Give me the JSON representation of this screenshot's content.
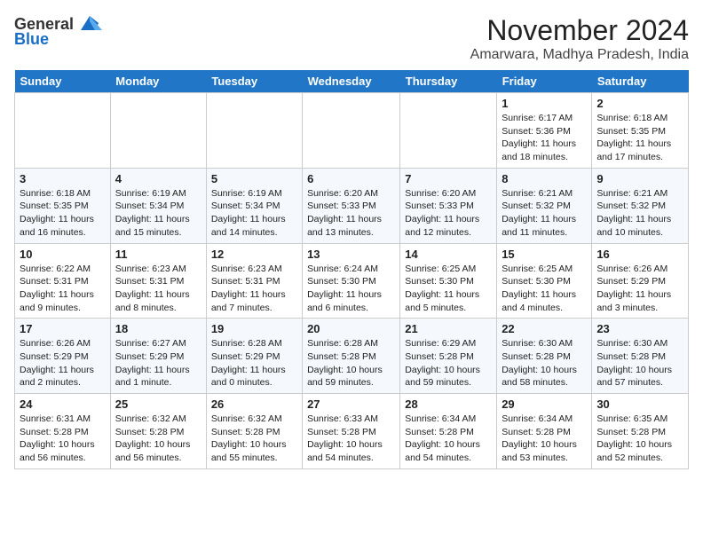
{
  "header": {
    "logo_general": "General",
    "logo_blue": "Blue",
    "month": "November 2024",
    "location": "Amarwara, Madhya Pradesh, India"
  },
  "days_of_week": [
    "Sunday",
    "Monday",
    "Tuesday",
    "Wednesday",
    "Thursday",
    "Friday",
    "Saturday"
  ],
  "weeks": [
    [
      {
        "day": "",
        "info": ""
      },
      {
        "day": "",
        "info": ""
      },
      {
        "day": "",
        "info": ""
      },
      {
        "day": "",
        "info": ""
      },
      {
        "day": "",
        "info": ""
      },
      {
        "day": "1",
        "info": "Sunrise: 6:17 AM\nSunset: 5:36 PM\nDaylight: 11 hours and 18 minutes."
      },
      {
        "day": "2",
        "info": "Sunrise: 6:18 AM\nSunset: 5:35 PM\nDaylight: 11 hours and 17 minutes."
      }
    ],
    [
      {
        "day": "3",
        "info": "Sunrise: 6:18 AM\nSunset: 5:35 PM\nDaylight: 11 hours and 16 minutes."
      },
      {
        "day": "4",
        "info": "Sunrise: 6:19 AM\nSunset: 5:34 PM\nDaylight: 11 hours and 15 minutes."
      },
      {
        "day": "5",
        "info": "Sunrise: 6:19 AM\nSunset: 5:34 PM\nDaylight: 11 hours and 14 minutes."
      },
      {
        "day": "6",
        "info": "Sunrise: 6:20 AM\nSunset: 5:33 PM\nDaylight: 11 hours and 13 minutes."
      },
      {
        "day": "7",
        "info": "Sunrise: 6:20 AM\nSunset: 5:33 PM\nDaylight: 11 hours and 12 minutes."
      },
      {
        "day": "8",
        "info": "Sunrise: 6:21 AM\nSunset: 5:32 PM\nDaylight: 11 hours and 11 minutes."
      },
      {
        "day": "9",
        "info": "Sunrise: 6:21 AM\nSunset: 5:32 PM\nDaylight: 11 hours and 10 minutes."
      }
    ],
    [
      {
        "day": "10",
        "info": "Sunrise: 6:22 AM\nSunset: 5:31 PM\nDaylight: 11 hours and 9 minutes."
      },
      {
        "day": "11",
        "info": "Sunrise: 6:23 AM\nSunset: 5:31 PM\nDaylight: 11 hours and 8 minutes."
      },
      {
        "day": "12",
        "info": "Sunrise: 6:23 AM\nSunset: 5:31 PM\nDaylight: 11 hours and 7 minutes."
      },
      {
        "day": "13",
        "info": "Sunrise: 6:24 AM\nSunset: 5:30 PM\nDaylight: 11 hours and 6 minutes."
      },
      {
        "day": "14",
        "info": "Sunrise: 6:25 AM\nSunset: 5:30 PM\nDaylight: 11 hours and 5 minutes."
      },
      {
        "day": "15",
        "info": "Sunrise: 6:25 AM\nSunset: 5:30 PM\nDaylight: 11 hours and 4 minutes."
      },
      {
        "day": "16",
        "info": "Sunrise: 6:26 AM\nSunset: 5:29 PM\nDaylight: 11 hours and 3 minutes."
      }
    ],
    [
      {
        "day": "17",
        "info": "Sunrise: 6:26 AM\nSunset: 5:29 PM\nDaylight: 11 hours and 2 minutes."
      },
      {
        "day": "18",
        "info": "Sunrise: 6:27 AM\nSunset: 5:29 PM\nDaylight: 11 hours and 1 minute."
      },
      {
        "day": "19",
        "info": "Sunrise: 6:28 AM\nSunset: 5:29 PM\nDaylight: 11 hours and 0 minutes."
      },
      {
        "day": "20",
        "info": "Sunrise: 6:28 AM\nSunset: 5:28 PM\nDaylight: 10 hours and 59 minutes."
      },
      {
        "day": "21",
        "info": "Sunrise: 6:29 AM\nSunset: 5:28 PM\nDaylight: 10 hours and 59 minutes."
      },
      {
        "day": "22",
        "info": "Sunrise: 6:30 AM\nSunset: 5:28 PM\nDaylight: 10 hours and 58 minutes."
      },
      {
        "day": "23",
        "info": "Sunrise: 6:30 AM\nSunset: 5:28 PM\nDaylight: 10 hours and 57 minutes."
      }
    ],
    [
      {
        "day": "24",
        "info": "Sunrise: 6:31 AM\nSunset: 5:28 PM\nDaylight: 10 hours and 56 minutes."
      },
      {
        "day": "25",
        "info": "Sunrise: 6:32 AM\nSunset: 5:28 PM\nDaylight: 10 hours and 56 minutes."
      },
      {
        "day": "26",
        "info": "Sunrise: 6:32 AM\nSunset: 5:28 PM\nDaylight: 10 hours and 55 minutes."
      },
      {
        "day": "27",
        "info": "Sunrise: 6:33 AM\nSunset: 5:28 PM\nDaylight: 10 hours and 54 minutes."
      },
      {
        "day": "28",
        "info": "Sunrise: 6:34 AM\nSunset: 5:28 PM\nDaylight: 10 hours and 54 minutes."
      },
      {
        "day": "29",
        "info": "Sunrise: 6:34 AM\nSunset: 5:28 PM\nDaylight: 10 hours and 53 minutes."
      },
      {
        "day": "30",
        "info": "Sunrise: 6:35 AM\nSunset: 5:28 PM\nDaylight: 10 hours and 52 minutes."
      }
    ]
  ]
}
